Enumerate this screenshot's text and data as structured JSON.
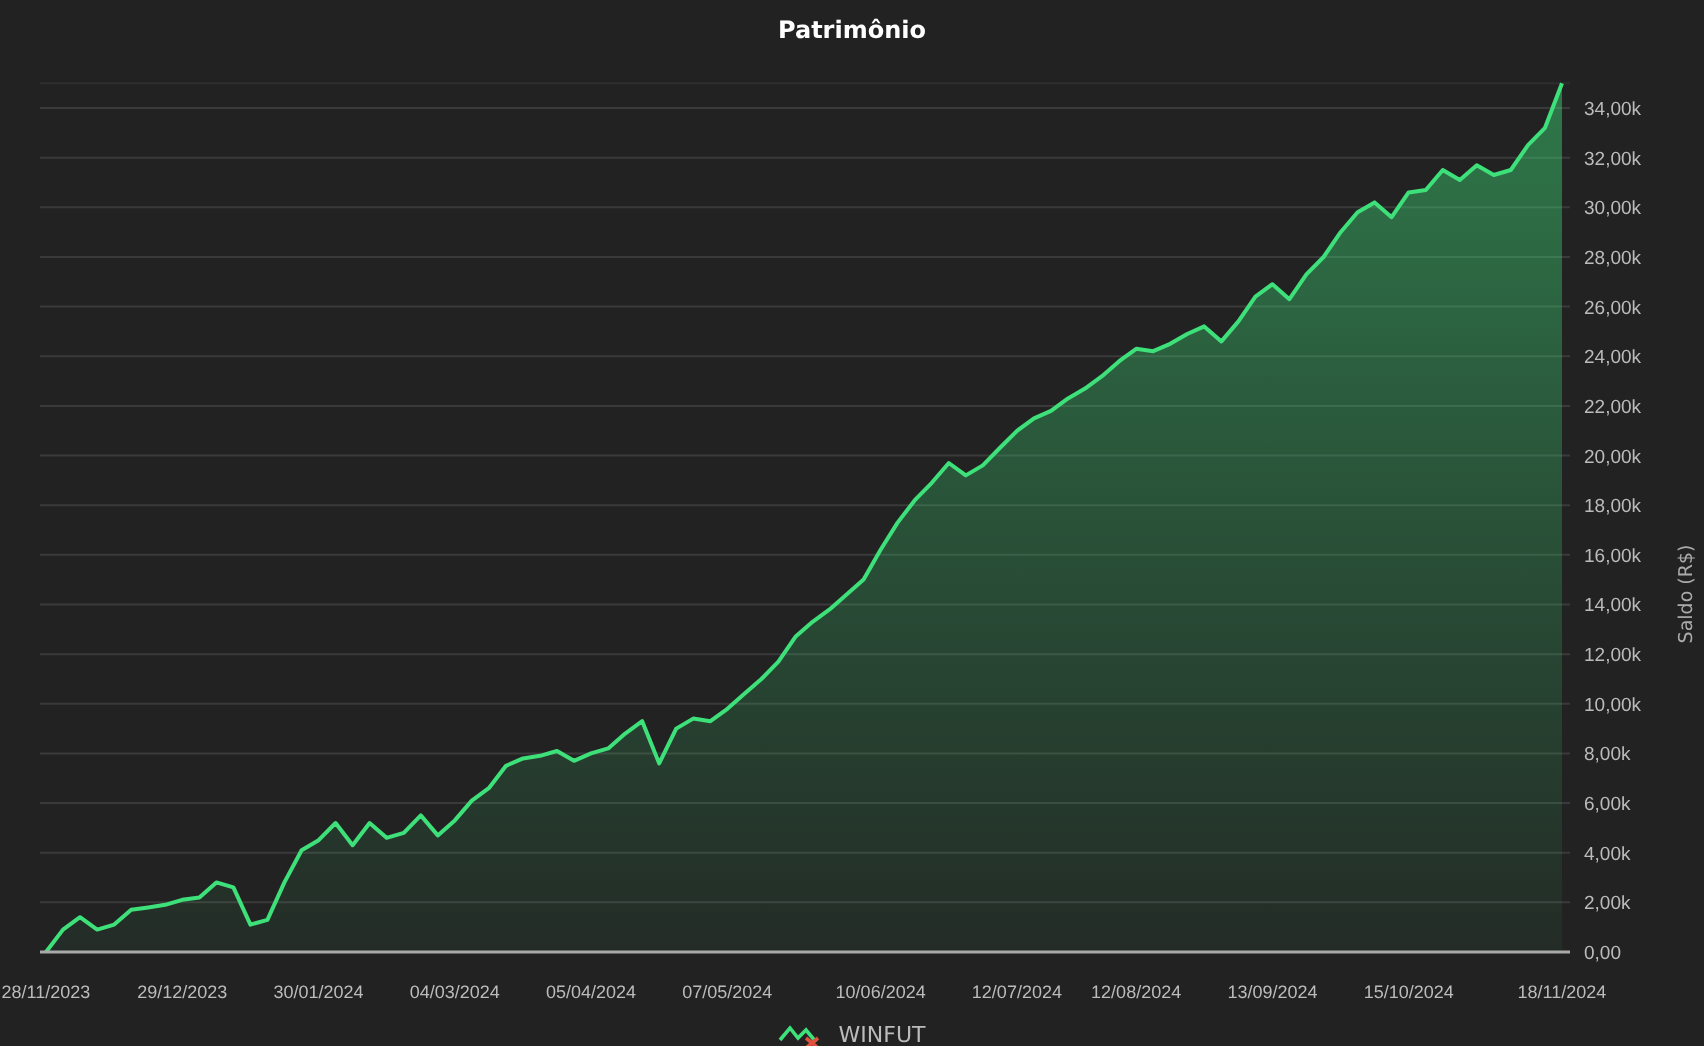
{
  "chart": {
    "chart_data": {
      "type": "area",
      "title": "Patrimônio",
      "ylabel": "Saldo (R$)",
      "categories": [
        "28/11/2023",
        null,
        null,
        null,
        null,
        null,
        null,
        null,
        "29/12/2023",
        null,
        null,
        null,
        null,
        null,
        null,
        null,
        "30/01/2024",
        null,
        null,
        null,
        null,
        null,
        null,
        null,
        "04/03/2024",
        null,
        null,
        null,
        null,
        null,
        null,
        null,
        "05/04/2024",
        null,
        null,
        null,
        null,
        null,
        null,
        null,
        "07/05/2024",
        null,
        null,
        null,
        null,
        null,
        null,
        null,
        null,
        "10/06/2024",
        null,
        null,
        null,
        null,
        null,
        null,
        null,
        "12/07/2024",
        null,
        null,
        null,
        null,
        null,
        null,
        "12/08/2024",
        null,
        null,
        null,
        null,
        null,
        null,
        null,
        "13/09/2024",
        null,
        null,
        null,
        null,
        null,
        null,
        null,
        "15/10/2024",
        null,
        null,
        null,
        null,
        null,
        null,
        null,
        null,
        "18/11/2024"
      ],
      "series": [
        {
          "name": "WINFUT",
          "color": "#3ee07a",
          "values": [
            0,
            900,
            1400,
            900,
            1100,
            1700,
            1800,
            1900,
            2100,
            2200,
            2800,
            2600,
            1100,
            1300,
            2800,
            4100,
            4500,
            5200,
            4300,
            5200,
            4600,
            4800,
            5500,
            4700,
            5300,
            6100,
            6600,
            7500,
            7800,
            7900,
            8100,
            7700,
            8000,
            8200,
            8800,
            9300,
            7600,
            9000,
            9400,
            9300,
            9800,
            10400,
            11000,
            11700,
            12700,
            13300,
            13800,
            14400,
            15000,
            16200,
            17300,
            18200,
            18900,
            19700,
            19200,
            19600,
            20300,
            21000,
            21500,
            21800,
            22300,
            22700,
            23200,
            23800,
            24300,
            24200,
            24500,
            24900,
            25200,
            24600,
            25400,
            26400,
            26900,
            26300,
            27300,
            28000,
            29000,
            29800,
            30200,
            29600,
            30600,
            30700,
            31500,
            31100,
            31700,
            31300,
            31500,
            32500,
            33200,
            35000
          ]
        }
      ],
      "grid": true,
      "ylim": [
        0,
        35000
      ],
      "yticks": [
        {
          "value": 0,
          "label": "0,00"
        },
        {
          "value": 2000,
          "label": "2,00k"
        },
        {
          "value": 4000,
          "label": "4,00k"
        },
        {
          "value": 6000,
          "label": "6,00k"
        },
        {
          "value": 8000,
          "label": "8,00k"
        },
        {
          "value": 10000,
          "label": "10,00k"
        },
        {
          "value": 12000,
          "label": "12,00k"
        },
        {
          "value": 14000,
          "label": "14,00k"
        },
        {
          "value": 16000,
          "label": "16,00k"
        },
        {
          "value": 18000,
          "label": "18,00k"
        },
        {
          "value": 20000,
          "label": "20,00k"
        },
        {
          "value": 22000,
          "label": "22,00k"
        },
        {
          "value": 24000,
          "label": "24,00k"
        },
        {
          "value": 26000,
          "label": "26,00k"
        },
        {
          "value": 28000,
          "label": "28,00k"
        },
        {
          "value": 30000,
          "label": "30,00k"
        },
        {
          "value": 32000,
          "label": "32,00k"
        },
        {
          "value": 34000,
          "label": "34,00k"
        }
      ]
    }
  }
}
